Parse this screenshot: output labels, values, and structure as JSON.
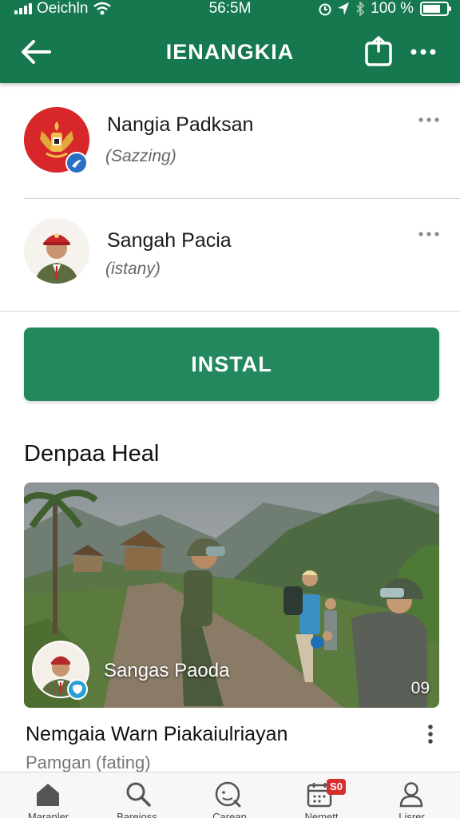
{
  "status_bar": {
    "carrier": "Oeichln",
    "time": "56:5M",
    "battery": "100 %"
  },
  "header": {
    "title": "IENANGKIA"
  },
  "channels": [
    {
      "name": "Nangia Padksan",
      "subtitle": "(Sazzing)"
    },
    {
      "name": "Sangah Pacia",
      "subtitle": "(istany)"
    }
  ],
  "install_button": {
    "label": "INSTAL"
  },
  "section": {
    "title": "Denpaa Heal"
  },
  "featured": {
    "caption": "Sangas Paoda",
    "count": "09"
  },
  "article": {
    "title": "Nemgaia Warn Piakaiulriayan",
    "subtitle": "Pamgan (fating)"
  },
  "tabs": [
    {
      "label": "Maranler",
      "icon": "home-icon"
    },
    {
      "label": "Bareioss",
      "icon": "search-icon"
    },
    {
      "label": "Carean",
      "icon": "compass-icon"
    },
    {
      "label": "Nemett",
      "icon": "calendar-icon",
      "badge": "S0"
    },
    {
      "label": "Lisrer",
      "icon": "profile-icon"
    }
  ],
  "colors": {
    "brand": "#16784f",
    "button": "#24885f",
    "badge": "#d62d2d"
  }
}
